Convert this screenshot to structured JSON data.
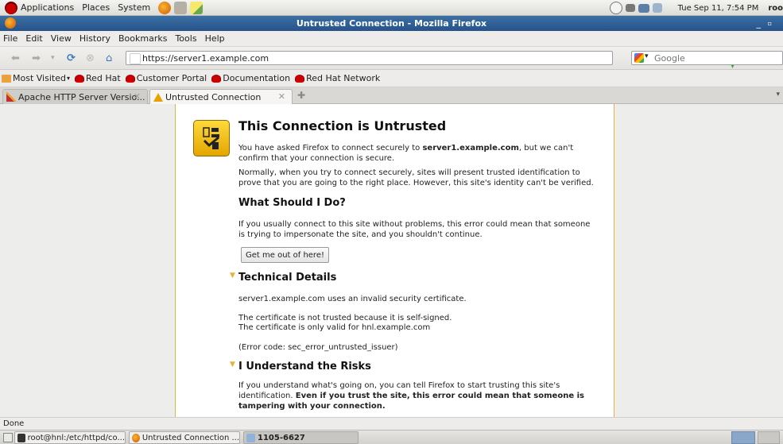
{
  "panel": {
    "menus": [
      "Applications",
      "Places",
      "System"
    ],
    "datetime": "Tue Sep 11,  7:54 PM",
    "user": "roo"
  },
  "window": {
    "title": "Untrusted Connection - Mozilla Firefox"
  },
  "menubar": [
    "File",
    "Edit",
    "View",
    "History",
    "Bookmarks",
    "Tools",
    "Help"
  ],
  "nav": {
    "url": "https://server1.example.com",
    "search_placeholder": "Google"
  },
  "bookmarks": [
    "Most Visited",
    "Red Hat",
    "Customer Portal",
    "Documentation",
    "Red Hat Network"
  ],
  "tabs": [
    {
      "label": "Apache HTTP Server Versio...",
      "active": false
    },
    {
      "label": "Untrusted Connection",
      "active": true
    }
  ],
  "error_page": {
    "title": "This Connection is Untrusted",
    "intro_pre": "You have asked Firefox to connect securely to ",
    "intro_host": "server1.example.com",
    "intro_post": ", but we can't confirm that your connection is secure.",
    "normally": "Normally, when you try to connect securely, sites will present trusted identification to prove that you are going to the right place. However, this site's identity can't be verified.",
    "what_heading": "What Should I Do?",
    "what_text": "If you usually connect to this site without problems, this error could mean that someone is trying to impersonate the site, and you shouldn't continue.",
    "get_out_button": "Get me out of here!",
    "tech_heading": "Technical Details",
    "tech_line1": "server1.example.com uses an invalid security certificate.",
    "tech_line2": "The certificate is not trusted because it is self-signed.",
    "tech_line3": "The certificate is only valid for hnl.example.com",
    "tech_code": "(Error code: sec_error_untrusted_issuer)",
    "risks_heading": "I Understand the Risks",
    "risks_pre": "If you understand what's going on, you can tell Firefox to start trusting this site's identification. ",
    "risks_bold": "Even if you trust the site, this error could mean that someone is tampering with your connection."
  },
  "status": {
    "text": "Done"
  },
  "taskbar": [
    {
      "label": "root@hnl:/etc/httpd/co...",
      "active": false
    },
    {
      "label": "Untrusted Connection ...",
      "active": false
    },
    {
      "label": "1105-6627",
      "active": true
    }
  ]
}
